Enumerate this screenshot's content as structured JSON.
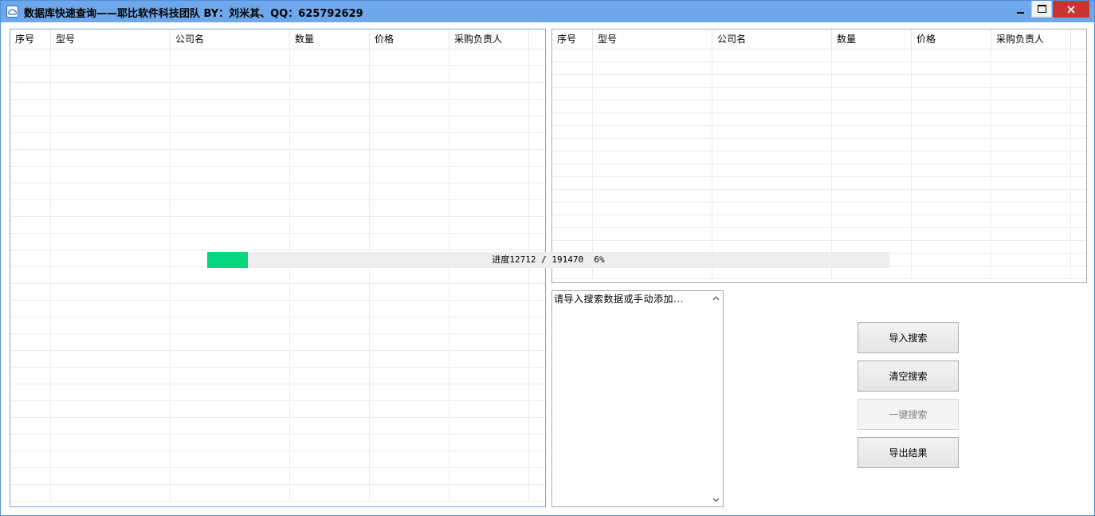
{
  "window": {
    "title": "数据库快速查询——耶比软件科技团队 BY：刘米其、QQ：625792629"
  },
  "left_list": {
    "columns": [
      "序号",
      "型号",
      "公司名",
      "数量",
      "价格",
      "采购负责人"
    ],
    "row_count": 27
  },
  "right_list": {
    "columns": [
      "序号",
      "型号",
      "公司名",
      "数量",
      "价格",
      "采购负责人"
    ],
    "row_count": 18
  },
  "progress": {
    "text": "进度12712 / 191470  6%",
    "current": 12712,
    "total": 191470,
    "percent": 6,
    "color": "#06d67e"
  },
  "search_box": {
    "placeholder": "请导入搜索数据或手动添加..."
  },
  "buttons": {
    "import": "导入搜索",
    "clear": "清空搜索",
    "one_click": "一键搜索",
    "export": "导出结果"
  },
  "colors": {
    "titlebar": "#6fa8ea",
    "close_button": "#c7372f"
  }
}
